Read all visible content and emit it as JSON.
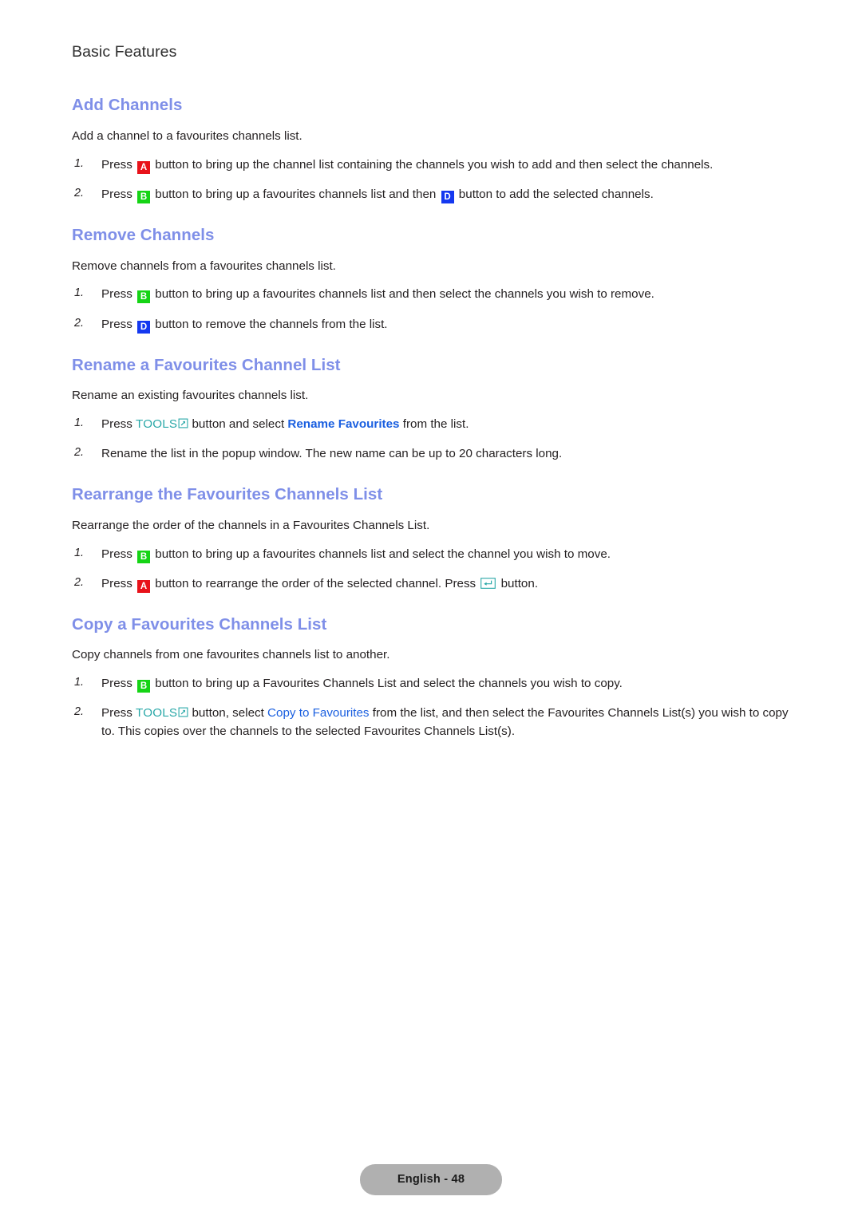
{
  "running_head": "Basic Features",
  "icons": {
    "key_a": "A",
    "key_b": "B",
    "key_d": "D",
    "tools_label": "TOOLS",
    "box_arrow_icon": "box-arrow-icon",
    "enter_icon": "enter-key-icon"
  },
  "colors": {
    "heading_blue": "#7f8fe8",
    "link_blue": "#1a5fe0",
    "tools_teal": "#2aa8a8",
    "key_red": "#e8121a",
    "key_green": "#15d415",
    "key_blue": "#1438f0",
    "body_text": "#231f20",
    "pill_background": "#b0b0b0"
  },
  "sections": [
    {
      "title": "Add Channels",
      "lead": "Add a channel to a favourites channels list.",
      "steps": [
        {
          "num": "1.",
          "parts": [
            {
              "t": "text",
              "v": "Press "
            },
            {
              "t": "key",
              "v": "A",
              "color": "red"
            },
            {
              "t": "text",
              "v": " button to bring up the channel list containing the channels you wish to add and then select the channels."
            }
          ]
        },
        {
          "num": "2.",
          "parts": [
            {
              "t": "text",
              "v": "Press "
            },
            {
              "t": "key",
              "v": "B",
              "color": "green"
            },
            {
              "t": "text",
              "v": " button to bring up a favourites channels list and then "
            },
            {
              "t": "key",
              "v": "D",
              "color": "blue"
            },
            {
              "t": "text",
              "v": " button to add the selected channels."
            }
          ]
        }
      ]
    },
    {
      "title": "Remove Channels",
      "lead": "Remove channels from a favourites channels list.",
      "steps": [
        {
          "num": "1.",
          "parts": [
            {
              "t": "text",
              "v": "Press "
            },
            {
              "t": "key",
              "v": "B",
              "color": "green"
            },
            {
              "t": "text",
              "v": " button to bring up a favourites channels list and then select the channels you wish to remove."
            }
          ]
        },
        {
          "num": "2.",
          "parts": [
            {
              "t": "text",
              "v": "Press "
            },
            {
              "t": "key",
              "v": "D",
              "color": "blue"
            },
            {
              "t": "text",
              "v": " button to remove the channels from the list."
            }
          ]
        }
      ]
    },
    {
      "title": "Rename a Favourites Channel List",
      "lead": "Rename an existing favourites channels list.",
      "steps": [
        {
          "num": "1.",
          "parts": [
            {
              "t": "text",
              "v": "Press "
            },
            {
              "t": "tools",
              "v": "TOOLS"
            },
            {
              "t": "text",
              "v": " button and select "
            },
            {
              "t": "link-bold",
              "v": "Rename Favourites"
            },
            {
              "t": "text",
              "v": " from the list."
            }
          ]
        },
        {
          "num": "2.",
          "parts": [
            {
              "t": "text",
              "v": "Rename the list in the popup window. The new name can be up to 20 characters long."
            }
          ]
        }
      ]
    },
    {
      "title": "Rearrange the Favourites Channels List",
      "lead": "Rearrange the order of the channels in a Favourites Channels List.",
      "steps": [
        {
          "num": "1.",
          "parts": [
            {
              "t": "text",
              "v": "Press "
            },
            {
              "t": "key",
              "v": "B",
              "color": "green"
            },
            {
              "t": "text",
              "v": " button to bring up a favourites channels list and select the channel you wish to move."
            }
          ]
        },
        {
          "num": "2.",
          "parts": [
            {
              "t": "text",
              "v": "Press "
            },
            {
              "t": "key",
              "v": "A",
              "color": "red"
            },
            {
              "t": "text",
              "v": " button to rearrange the order of the selected channel. Press "
            },
            {
              "t": "enter",
              "v": ""
            },
            {
              "t": "text",
              "v": " button."
            }
          ]
        }
      ]
    },
    {
      "title": "Copy a Favourites Channels List",
      "lead": "Copy channels from one favourites channels list to another.",
      "steps": [
        {
          "num": "1.",
          "parts": [
            {
              "t": "text",
              "v": "Press "
            },
            {
              "t": "key",
              "v": "B",
              "color": "green"
            },
            {
              "t": "text",
              "v": " button to bring up a Favourites Channels List and select the channels you wish to copy."
            }
          ]
        },
        {
          "num": "2.",
          "parts": [
            {
              "t": "text",
              "v": "Press "
            },
            {
              "t": "tools",
              "v": "TOOLS"
            },
            {
              "t": "text",
              "v": " button, select "
            },
            {
              "t": "link",
              "v": "Copy to Favourites"
            },
            {
              "t": "text",
              "v": " from the list, and then select the Favourites Channels List(s) you wish to copy to. This copies over the channels to the selected Favourites Channels List(s)."
            }
          ]
        }
      ]
    }
  ],
  "footer": {
    "page_label": "English - 48"
  }
}
